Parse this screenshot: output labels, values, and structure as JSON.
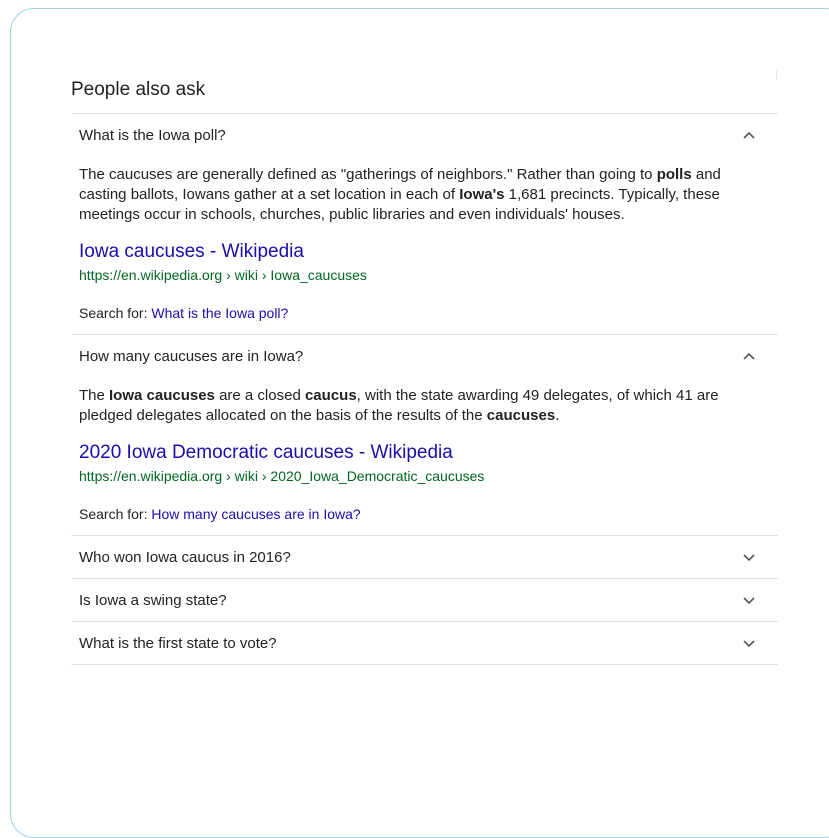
{
  "paa": {
    "title": "People also ask",
    "expanded": [
      {
        "question": "What is the Iowa poll?",
        "chevron": "chevron-up-icon",
        "snippet": [
          {
            "t": "The caucuses are generally defined as \"gatherings of neighbors.\" Rather than going to ",
            "b": false
          },
          {
            "t": "polls",
            "b": true
          },
          {
            "t": " and casting ballots, Iowans gather at a set location in each of ",
            "b": false
          },
          {
            "t": "Iowa's",
            "b": true
          },
          {
            "t": " 1,681 precincts. Typically, these meetings occur in schools, churches, public libraries and even individuals' houses.",
            "b": false
          }
        ],
        "result_title": "Iowa caucuses - Wikipedia",
        "result_url": "https://en.wikipedia.org › wiki › Iowa_caucuses",
        "search_for_label": "Search for: ",
        "search_for_link": "What is the Iowa poll?"
      },
      {
        "question": "How many caucuses are in Iowa?",
        "chevron": "chevron-up-icon",
        "snippet": [
          {
            "t": "The ",
            "b": false
          },
          {
            "t": "Iowa caucuses",
            "b": true
          },
          {
            "t": " are a closed ",
            "b": false
          },
          {
            "t": "caucus",
            "b": true
          },
          {
            "t": ", with the state awarding 49 delegates, of which 41 are pledged delegates allocated on the basis of the results of the ",
            "b": false
          },
          {
            "t": "caucuses",
            "b": true
          },
          {
            "t": ".",
            "b": false
          }
        ],
        "result_title": "2020 Iowa Democratic caucuses - Wikipedia",
        "result_url": "https://en.wikipedia.org › wiki › 2020_Iowa_Democratic_caucuses",
        "search_for_label": "Search for: ",
        "search_for_link": "How many caucuses are in Iowa?"
      }
    ],
    "collapsed": [
      {
        "question": "Who won Iowa caucus in 2016?",
        "chevron": "chevron-down-icon"
      },
      {
        "question": "Is Iowa a swing state?",
        "chevron": "chevron-down-icon"
      },
      {
        "question": "What is the first state to vote?",
        "chevron": "chevron-down-icon"
      }
    ]
  },
  "colors": {
    "link": "#1a0dab",
    "url": "#006621",
    "text": "#222222",
    "divider": "#e2e2e2",
    "card_border": "#9fd3ea"
  }
}
